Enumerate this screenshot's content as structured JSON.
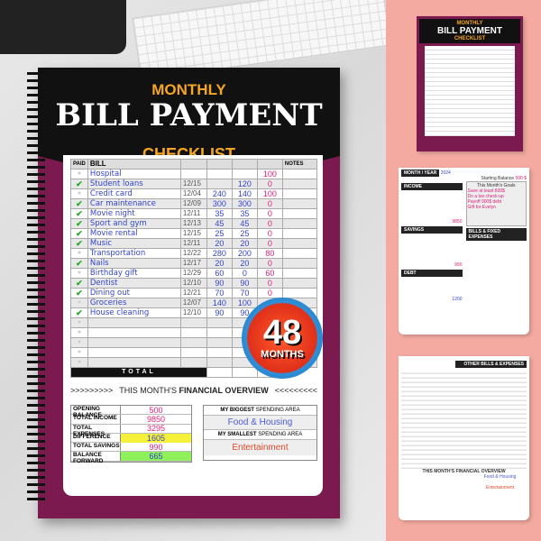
{
  "cover": {
    "title_top": "MONTHLY",
    "title_main": "BILL PAYMENT",
    "title_bottom": "CHECKLIST"
  },
  "table": {
    "headers": [
      "PAID",
      "BILL",
      "",
      "",
      "",
      "",
      "NOTES"
    ],
    "rows": [
      {
        "paid": false,
        "bill": "Hospital",
        "date": "",
        "amount": "",
        "paid_amt": "",
        "left": "100"
      },
      {
        "paid": true,
        "bill": "Student loans",
        "date": "12/15",
        "amount": "",
        "paid_amt": "120",
        "left": "0"
      },
      {
        "paid": false,
        "bill": "Credit card",
        "date": "12/04",
        "amount": "240",
        "paid_amt": "140",
        "left": "100"
      },
      {
        "paid": true,
        "bill": "Car maintenance",
        "date": "12/09",
        "amount": "300",
        "paid_amt": "300",
        "left": "0"
      },
      {
        "paid": true,
        "bill": "Movie night",
        "date": "12/11",
        "amount": "35",
        "paid_amt": "35",
        "left": "0"
      },
      {
        "paid": true,
        "bill": "Sport and gym",
        "date": "12/13",
        "amount": "45",
        "paid_amt": "45",
        "left": "0"
      },
      {
        "paid": true,
        "bill": "Movie rental",
        "date": "12/15",
        "amount": "25",
        "paid_amt": "25",
        "left": "0"
      },
      {
        "paid": true,
        "bill": "Music",
        "date": "12/11",
        "amount": "20",
        "paid_amt": "20",
        "left": "0"
      },
      {
        "paid": false,
        "bill": "Transportation",
        "date": "12/22",
        "amount": "280",
        "paid_amt": "200",
        "left": "80"
      },
      {
        "paid": true,
        "bill": "Nails",
        "date": "12/17",
        "amount": "20",
        "paid_amt": "20",
        "left": "0"
      },
      {
        "paid": false,
        "bill": "Birthday gift",
        "date": "12/29",
        "amount": "60",
        "paid_amt": "0",
        "left": "60"
      },
      {
        "paid": true,
        "bill": "Dentist",
        "date": "12/10",
        "amount": "90",
        "paid_amt": "90",
        "left": "0"
      },
      {
        "paid": true,
        "bill": "Dining out",
        "date": "12/21",
        "amount": "70",
        "paid_amt": "70",
        "left": "0"
      },
      {
        "paid": false,
        "bill": "Groceries",
        "date": "12/07",
        "amount": "140",
        "paid_amt": "100",
        "left": "40"
      },
      {
        "paid": true,
        "bill": "House cleaning",
        "date": "12/10",
        "amount": "90",
        "paid_amt": "90",
        "left": ""
      }
    ],
    "empty_rows": 5,
    "total_label": "TOTAL"
  },
  "overview": {
    "arrows_left": ">>>>>>>>>",
    "title_a": "THIS MONTH'S ",
    "title_b": "FINANCIAL OVERVIEW",
    "arrows_right": "<<<<<<<<<",
    "items": [
      {
        "label": "OPENING BALANCE",
        "value": "500",
        "highlight": ""
      },
      {
        "label": "TOTAL INCOME",
        "value": "9850",
        "highlight": ""
      },
      {
        "label": "TOTAL EXPENSES",
        "value": "3295",
        "highlight": ""
      },
      {
        "label": "DIFFERENCE",
        "value": "1605",
        "highlight": "#f5f03a"
      },
      {
        "label": "TOTAL SAVINGS",
        "value": "990",
        "highlight": ""
      },
      {
        "label": "BALANCE FORWARD",
        "value": "665",
        "highlight": "#8ef05a"
      }
    ],
    "biggest_label_a": "MY BIGGEST",
    "biggest_label_b": " SPENDING AREA",
    "biggest_value": "Food & Housing",
    "smallest_label_a": "MY SMALLEST",
    "smallest_label_b": " SPENDING AREA",
    "smallest_value": "Entertainment"
  },
  "badge": {
    "number": "48",
    "unit": "MONTHS"
  },
  "thumb2": {
    "month_year": "MONTH / YEAR",
    "year": "2024",
    "starting_balance": "Starting Balance",
    "starting_value": "500 $",
    "income": "INCOME",
    "goals": "This Month's Goals",
    "goal_items": [
      "Save at least 800$",
      "Do a tax check-up",
      "Payoff 900$ debt",
      "Gift for Evelyn"
    ],
    "income_total": "9850",
    "savings": "SAVINGS",
    "savings_total": "990",
    "bills": "BILLS & FIXED EXPENSES",
    "debt": "DEBT",
    "debt_total": "1200"
  },
  "thumb3": {
    "header": "OTHER BILLS & EXPENSES",
    "overview": "THIS MONTH'S FINANCIAL OVERVIEW",
    "biggest": "Food & Housing",
    "smallest": "Entertainment"
  },
  "colors": {
    "purple": "#7a1a4e",
    "orange": "#f5a623",
    "pink_bg": "#f4aaa0",
    "hand_blue": "#3344cc",
    "hand_pink": "#e0207a"
  }
}
